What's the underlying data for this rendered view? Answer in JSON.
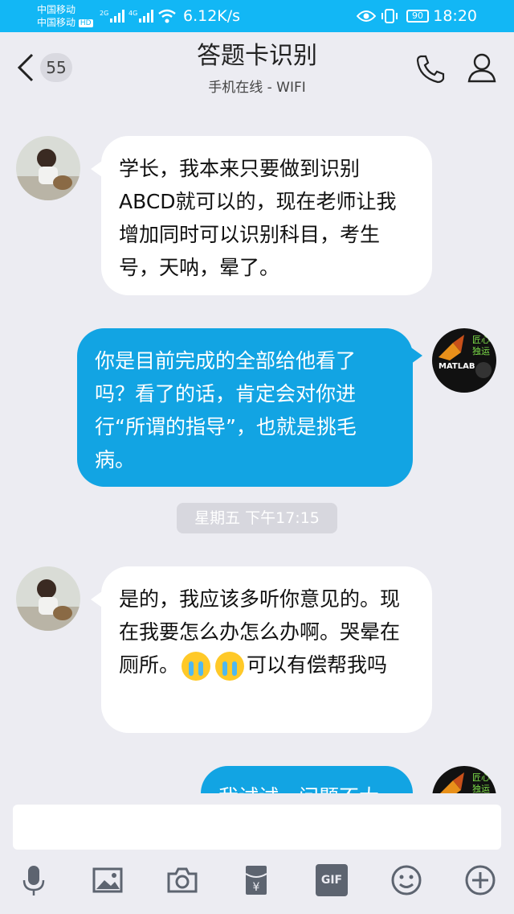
{
  "status_bar": {
    "carrier_1": "中国移动",
    "carrier_2": "中国移动",
    "hd_label": "HD",
    "signal_1": "2G",
    "signal_2": "4G",
    "speed": "6.12K/s",
    "battery": "90",
    "time": "18:20"
  },
  "header": {
    "unread_count": "55",
    "title": "答题卡识别",
    "subtitle": "手机在线 - WIFI"
  },
  "messages": [
    {
      "sender": "them",
      "text": "学长，我本来只要做到识别ABCD就可以的，现在老师让我增加同时可以识别科目，考生号，天呐，晕了。"
    },
    {
      "sender": "me",
      "text": "你是目前完成的全部给他看了吗？看了的话，肯定会对你进行“所谓的指导”，也就是挑毛病。"
    },
    {
      "sender": "them",
      "text_before": "是的，我应该多听你意见的。现在我要怎么办怎么办啊。哭晕在厕所。",
      "text_after": "可以有偿帮我吗"
    },
    {
      "sender": "me",
      "text": "我试试，问题不大"
    }
  ],
  "time_separator": "星期五 下午17:15",
  "my_avatar": {
    "label_1": "匠心",
    "label_2": "独运",
    "label_3": "MATLAB"
  },
  "input": {
    "placeholder": ""
  },
  "toolbar": {
    "gif_label": "GIF"
  },
  "colors": {
    "accent": "#12b7f5",
    "out_bubble": "#12a4e3",
    "background": "#ececf2"
  }
}
